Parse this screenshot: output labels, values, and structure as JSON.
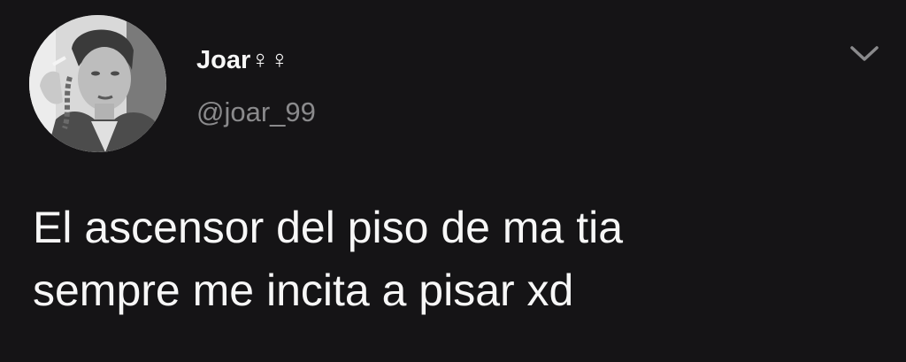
{
  "tweet": {
    "author": {
      "display_name": "Joar♀♀",
      "handle": "@joar_99",
      "avatar": "profile-photo"
    },
    "menu_icon": "chevron-down-icon",
    "text_lines": [
      "El ascensor del piso de ma tia",
      "sempre me incita a pisar xd"
    ]
  },
  "colors": {
    "background": "#151416",
    "primary_text": "#f7f7f7",
    "secondary_text": "#8a8a8c",
    "icon": "#8a8a8c"
  }
}
